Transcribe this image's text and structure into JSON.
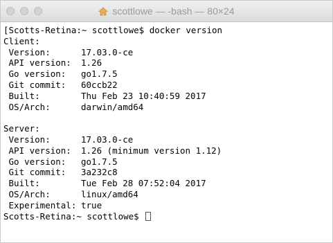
{
  "window": {
    "title": "scottlowe — -bash — 80×24"
  },
  "terminal": {
    "prompt_command": "[Scotts-Retina:~ scottlowe$ docker version",
    "client_header": "Client:",
    "client": [
      {
        "key": " Version:",
        "value": "17.03.0-ce"
      },
      {
        "key": " API version:",
        "value": "1.26"
      },
      {
        "key": " Go version:",
        "value": "go1.7.5"
      },
      {
        "key": " Git commit:",
        "value": "60ccb22"
      },
      {
        "key": " Built:",
        "value": "Thu Feb 23 10:40:59 2017"
      },
      {
        "key": " OS/Arch:",
        "value": "darwin/amd64"
      }
    ],
    "server_header": "Server:",
    "server": [
      {
        "key": " Version:",
        "value": "17.03.0-ce"
      },
      {
        "key": " API version:",
        "value": "1.26 (minimum version 1.12)"
      },
      {
        "key": " Go version:",
        "value": "go1.7.5"
      },
      {
        "key": " Git commit:",
        "value": "3a232c8"
      },
      {
        "key": " Built:",
        "value": "Tue Feb 28 07:52:04 2017"
      },
      {
        "key": " OS/Arch:",
        "value": "linux/amd64"
      },
      {
        "key": " Experimental:",
        "value": "true"
      }
    ],
    "final_prompt": "Scotts-Retina:~ scottlowe$"
  },
  "icons": {
    "home": "home-icon"
  }
}
